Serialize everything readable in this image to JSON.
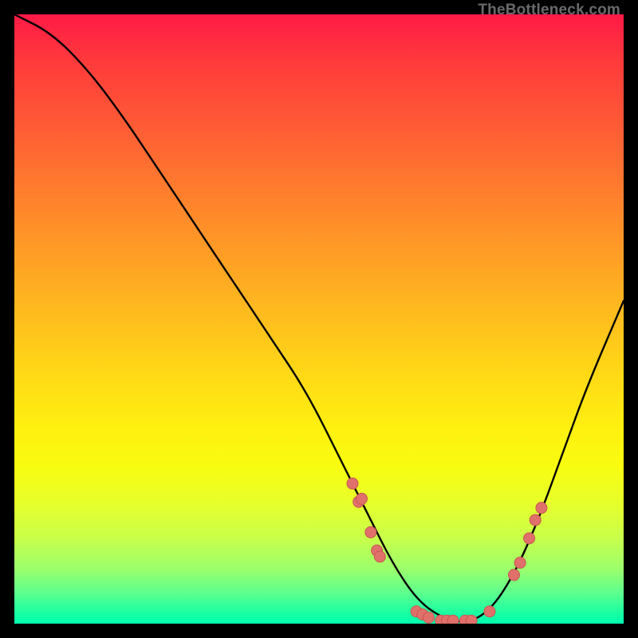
{
  "watermark": "TheBottleneck.com",
  "colors": {
    "background": "#000000",
    "curve_stroke": "#000000",
    "marker_fill": "#e0706a",
    "marker_stroke": "#c95650"
  },
  "chart_data": {
    "type": "line",
    "title": "",
    "xlabel": "",
    "ylabel": "",
    "xlim": [
      0,
      100
    ],
    "ylim": [
      0,
      100
    ],
    "grid": false,
    "series": [
      {
        "name": "bottleneck-curve",
        "x": [
          0,
          6,
          12,
          18,
          24,
          30,
          36,
          42,
          48,
          54,
          58,
          62,
          66,
          70,
          74,
          78,
          82,
          86,
          90,
          94,
          100
        ],
        "y": [
          100,
          97,
          91,
          83,
          74,
          65,
          56,
          47,
          38,
          26,
          18,
          10,
          4,
          1,
          0,
          2,
          8,
          17,
          28,
          39,
          53
        ]
      }
    ],
    "markers": [
      {
        "x": 55.5,
        "y": 23
      },
      {
        "x": 56.5,
        "y": 20
      },
      {
        "x": 57,
        "y": 20.5
      },
      {
        "x": 58.5,
        "y": 15
      },
      {
        "x": 59.5,
        "y": 12
      },
      {
        "x": 60,
        "y": 11
      },
      {
        "x": 66,
        "y": 2
      },
      {
        "x": 67,
        "y": 1.5
      },
      {
        "x": 68,
        "y": 1
      },
      {
        "x": 70,
        "y": 0.5
      },
      {
        "x": 71,
        "y": 0.5
      },
      {
        "x": 72,
        "y": 0.5
      },
      {
        "x": 74,
        "y": 0.5
      },
      {
        "x": 75,
        "y": 0.5
      },
      {
        "x": 78,
        "y": 2
      },
      {
        "x": 82,
        "y": 8
      },
      {
        "x": 83,
        "y": 10
      },
      {
        "x": 84.5,
        "y": 14
      },
      {
        "x": 85.5,
        "y": 17
      },
      {
        "x": 86.5,
        "y": 19
      }
    ]
  }
}
